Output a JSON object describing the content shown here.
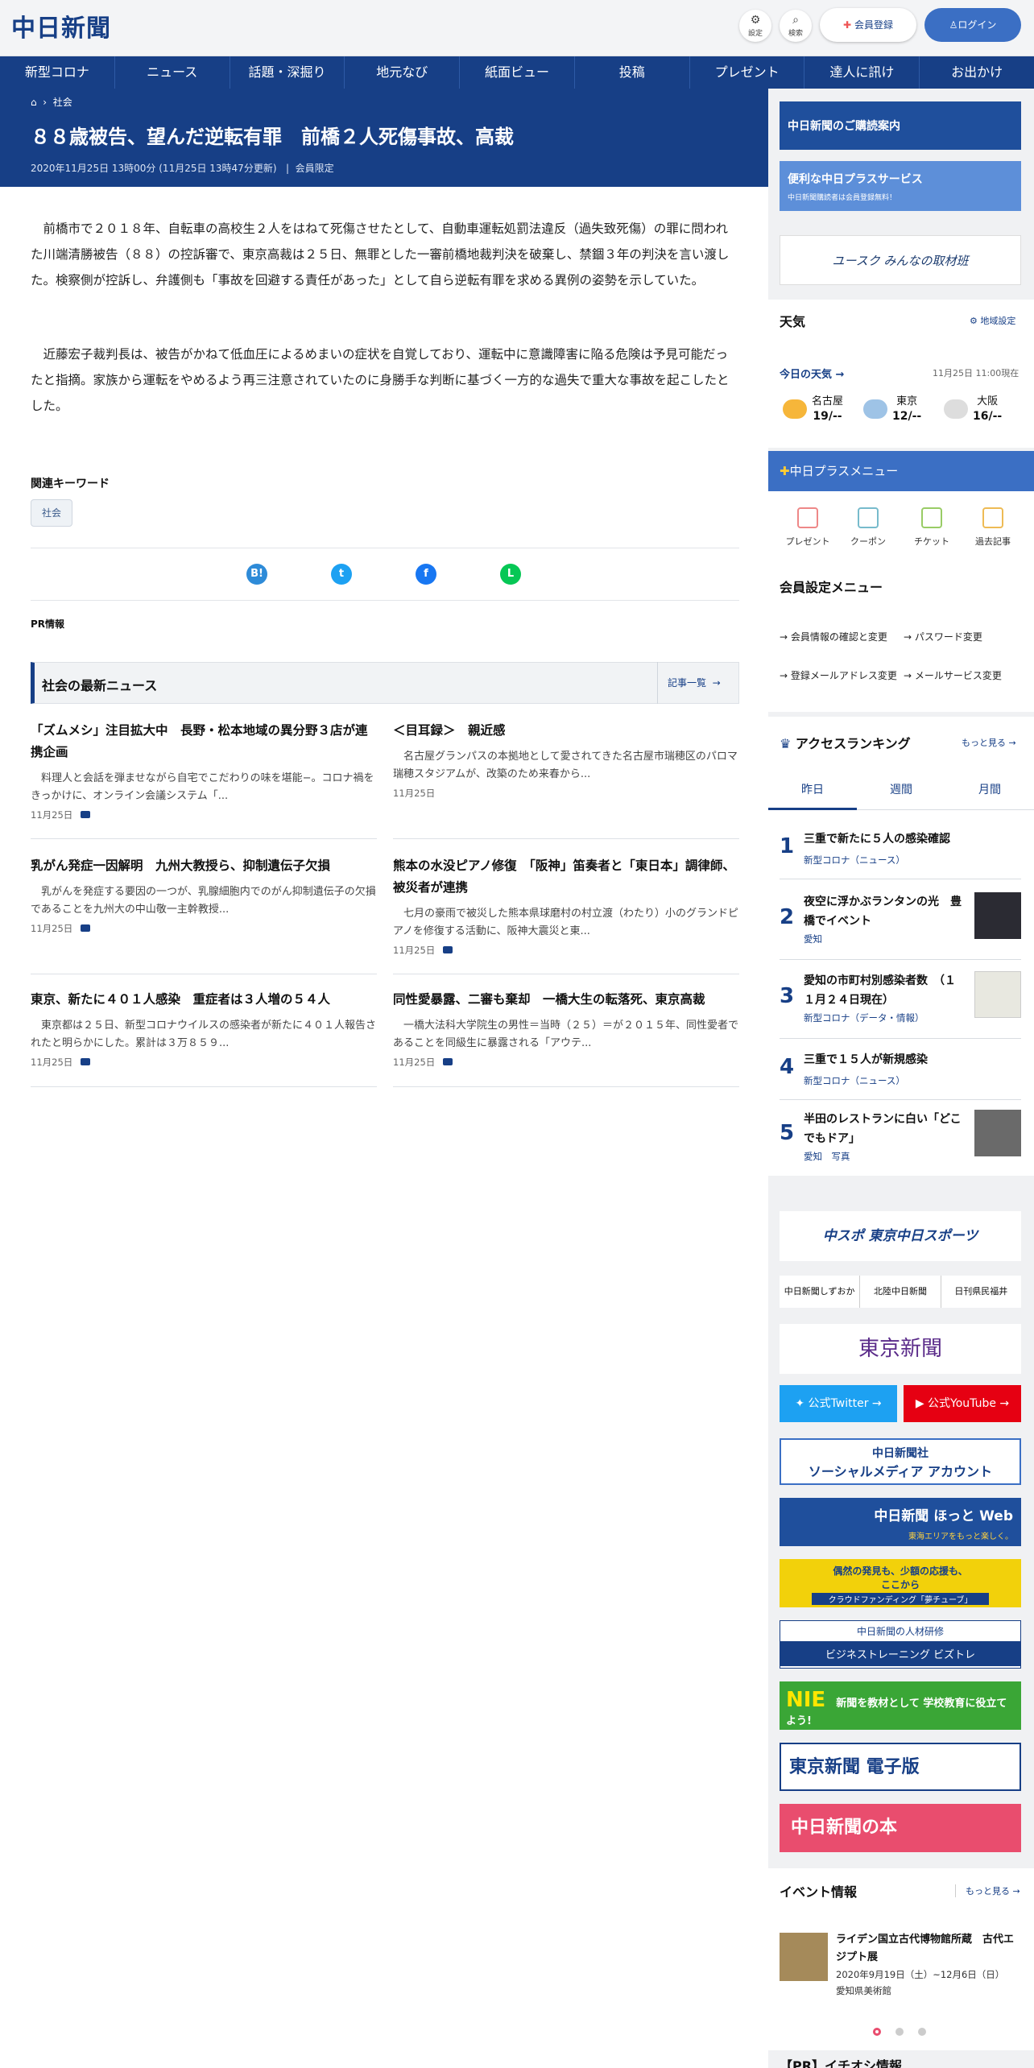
{
  "header": {
    "logo": "中日新聞",
    "settings_label": "設定",
    "search_label": "検索",
    "signup_label": "会員登録",
    "login_label": "ログイン"
  },
  "nav": [
    "新型コロナ",
    "ニュース",
    "話題・深掘り",
    "地元なび",
    "紙面ビュー",
    "投稿",
    "プレゼント",
    "達人に訊け",
    "お出かけ"
  ],
  "article": {
    "breadcrumb": "社会",
    "title": "８８歳被告、望んだ逆転有罪　前橋２人死傷事故、高裁",
    "date": "2020年11月25日 13時00分 (11月25日 13時47分更新)",
    "badge": "会員限定",
    "paragraphs": [
      "前橋市で２０１８年、自転車の高校生２人をはねて死傷させたとして、自動車運転処罰法違反（過失致死傷）の罪に問われた川端清勝被告（８８）の控訴審で、東京高裁は２５日、無罪とした一審前橋地裁判決を破棄し、禁錮３年の判決を言い渡した。検察側が控訴し、弁護側も「事故を回避する責任があった」として自ら逆転有罪を求める異例の姿勢を示していた。",
      "近藤宏子裁判長は、被告がかねて低血圧によるめまいの症状を自覚しており、運転中に意識障害に陥る危険は予見可能だったと指摘。家族から運転をやめるよう再三注意されていたのに身勝手な判断に基づく一方的な過失で重大な事故を起こしたとした。"
    ],
    "keywords_label": "関連キーワード",
    "keyword": "社会",
    "share": [
      "B!",
      "t",
      "f",
      "L"
    ],
    "pr_label": "PR情報"
  },
  "latest": {
    "title": "社会の最新ニュース",
    "all_label": "記事一覧",
    "items": [
      {
        "title": "「ズムメシ」注目拡大中　長野・松本地域の異分野３店が連携企画",
        "text": "料理人と会話を弾ませながら自宅でこだわりの味を堪能−。コロナ禍をきっかけに、オンライン会議システム「...",
        "date": "11月25日",
        "photo": true
      },
      {
        "title": "＜目耳録＞　親近感",
        "text": "名古屋グランパスの本拠地として愛されてきた名古屋市瑞穂区のパロマ瑞穂スタジアムが、改築のため来春から...",
        "date": "11月25日",
        "photo": false
      },
      {
        "title": "乳がん発症一因解明　九州大教授ら、抑制遺伝子欠損",
        "text": "乳がんを発症する要因の一つが、乳腺細胞内でのがん抑制遺伝子の欠損であることを九州大の中山敬一主幹教授...",
        "date": "11月25日",
        "photo": true
      },
      {
        "title": "熊本の水没ピアノ修復　「阪神」笛奏者と「東日本」調律師、被災者が連携",
        "text": "七月の豪雨で被災した熊本県球磨村の村立渡（わたり）小のグランドピアノを修復する活動に、阪神大震災と東...",
        "date": "11月25日",
        "photo": true
      },
      {
        "title": "東京、新たに４０１人感染　重症者は３人増の５４人",
        "text": "東京都は２５日、新型コロナウイルスの感染者が新たに４０１人報告されたと明らかにした。累計は３万８５９...",
        "date": "11月25日",
        "photo": true
      },
      {
        "title": "同性愛暴露、二審も棄却　一橋大生の転落死、東京高裁",
        "text": "一橋大法科大学院生の男性＝当時（２５）＝が２０１５年、同性愛者であることを同級生に暴露される「アウテ...",
        "date": "11月25日",
        "photo": true
      }
    ]
  },
  "sidebar": {
    "banner1": "中日新聞のご購読案内",
    "banner2_title": "便利な中日プラスサービス",
    "banner2_sub": "中日新聞購読者は会員登録無料！",
    "banner3": "ユースク みんなの取材班",
    "weather": {
      "title": "天気",
      "settings": "地域設定",
      "today": "今日の天気",
      "time": "11月25日 11:00現在",
      "cities": [
        {
          "name": "名古屋",
          "temp": "19/--"
        },
        {
          "name": "東京",
          "temp": "12/--"
        },
        {
          "name": "大阪",
          "temp": "16/--"
        }
      ]
    },
    "plus_menu": {
      "title": "中日プラスメニュー",
      "items": [
        "プレゼント",
        "クーポン",
        "チケット",
        "過去記事"
      ]
    },
    "member": {
      "title": "会員設定メニュー",
      "links": [
        "会員情報の確認と変更",
        "パスワード変更",
        "登録メールアドレス変更",
        "メールサービス変更"
      ]
    },
    "ranking": {
      "title": "アクセスランキング",
      "more": "もっと見る",
      "tabs": [
        "昨日",
        "週間",
        "月間"
      ],
      "items": [
        {
          "n": "1",
          "title": "三重で新たに５人の感染確認",
          "cat": "新型コロナ（ニュース）"
        },
        {
          "n": "2",
          "title": "夜空に浮かぶランタンの光　豊橋でイベント",
          "cat": "愛知"
        },
        {
          "n": "3",
          "title": "愛知の市町村別感染者数　（１１月２４日現在）",
          "cat": "新型コロナ（データ・情報）"
        },
        {
          "n": "4",
          "title": "三重で１５人が新規感染",
          "cat": "新型コロナ（ニュース）"
        },
        {
          "n": "5",
          "title": "半田のレストランに白い「どこでもドア」",
          "cat": "愛知　写真"
        }
      ]
    },
    "chuspo": "中スポ 東京中日スポーツ",
    "regional": [
      "中日新聞しずおか",
      "北陸中日新聞",
      "日刊県民福井"
    ],
    "tokyo": "東京新聞",
    "twitter": "公式Twitter",
    "youtube": "公式YouTube",
    "social": [
      "中日新聞社",
      "ソーシャルメディア アカウント"
    ],
    "hot_web": [
      "中日新聞 ほっと Web",
      "東海エリアをもっと楽しく。"
    ],
    "yume": [
      "偶然の発見も、少額の応援も、",
      "ここから",
      "クラウドファンディング「夢チューブ」"
    ],
    "bizutore": [
      "中日新聞の人材研修",
      "ビジネストレーニング ビズトレ"
    ],
    "nie": [
      "NIE",
      "新聞を教材として 学校教育に役立てよう!"
    ],
    "tokyo_digital": "東京新聞 電子版",
    "books": "中日新聞の本",
    "events": {
      "title": "イベント情報",
      "more": "もっと見る",
      "name": "ライデン国立古代博物館所蔵　古代エジプト展",
      "date": "2020年9月19日（土）~12月6日（日）",
      "place": "愛知県美術館"
    },
    "pr_bottom": "【PR】イチオシ情報"
  },
  "colors": {
    "navy": "#173f86",
    "blue": "#3b6fc4",
    "twitter": "#1da1f2",
    "youtube": "#e60012"
  }
}
